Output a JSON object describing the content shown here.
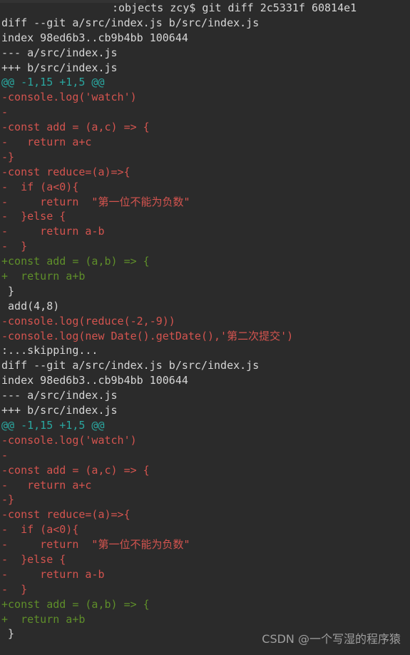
{
  "terminal": {
    "background_color": "#2b2b2b",
    "colors": {
      "default": "#d6d6d6",
      "hunk_header": "#2aa7a0",
      "deleted": "#d4544f",
      "added": "#5f8f2a",
      "watermark": "#a8a8a8"
    },
    "prompt": {
      "host_path": ":objects",
      "user": "zcy",
      "symbol": "$",
      "command": "git diff 2c5331f 60814e1",
      "full_line": ":objects zcy$ git diff 2c5331f 60814e1"
    },
    "lines": [
      {
        "text": ":objects zcy$ git diff 2c5331f 60814e1",
        "role": "prompt"
      },
      {
        "text": "diff --git a/src/index.js b/src/index.js",
        "role": "meta"
      },
      {
        "text": "index 98ed6b3..cb9b4bb 100644",
        "role": "meta"
      },
      {
        "text": "--- a/src/index.js",
        "role": "meta"
      },
      {
        "text": "+++ b/src/index.js",
        "role": "meta"
      },
      {
        "text": "@@ -1,15 +1,5 @@",
        "role": "hunk"
      },
      {
        "text": "-console.log('watch')",
        "role": "del"
      },
      {
        "text": "-",
        "role": "del"
      },
      {
        "text": "-const add = (a,c) => {",
        "role": "del"
      },
      {
        "text": "-   return a+c",
        "role": "del"
      },
      {
        "text": "-}",
        "role": "del"
      },
      {
        "text": "-const reduce=(a)=>{",
        "role": "del"
      },
      {
        "text": "-  if (a<0){",
        "role": "del"
      },
      {
        "text": "-     return  \"第一位不能为负数\"",
        "role": "del"
      },
      {
        "text": "-  }else {",
        "role": "del"
      },
      {
        "text": "-     return a-b",
        "role": "del"
      },
      {
        "text": "-  }",
        "role": "del"
      },
      {
        "text": "+const add = (a,b) => {",
        "role": "add"
      },
      {
        "text": "+  return a+b",
        "role": "add"
      },
      {
        "text": " }",
        "role": "default"
      },
      {
        "text": " add(4,8)",
        "role": "default"
      },
      {
        "text": "-console.log(reduce(-2,-9))",
        "role": "del"
      },
      {
        "text": "-console.log(new Date().getDate(),'第二次提交')",
        "role": "del"
      },
      {
        "text": ":...skipping...",
        "role": "pager"
      },
      {
        "text": "diff --git a/src/index.js b/src/index.js",
        "role": "meta"
      },
      {
        "text": "index 98ed6b3..cb9b4bb 100644",
        "role": "meta"
      },
      {
        "text": "--- a/src/index.js",
        "role": "meta"
      },
      {
        "text": "+++ b/src/index.js",
        "role": "meta"
      },
      {
        "text": "@@ -1,15 +1,5 @@",
        "role": "hunk"
      },
      {
        "text": "-console.log('watch')",
        "role": "del"
      },
      {
        "text": "-",
        "role": "del"
      },
      {
        "text": "-const add = (a,c) => {",
        "role": "del"
      },
      {
        "text": "-   return a+c",
        "role": "del"
      },
      {
        "text": "-}",
        "role": "del"
      },
      {
        "text": "-const reduce=(a)=>{",
        "role": "del"
      },
      {
        "text": "-  if (a<0){",
        "role": "del"
      },
      {
        "text": "-     return  \"第一位不能为负数\"",
        "role": "del"
      },
      {
        "text": "-  }else {",
        "role": "del"
      },
      {
        "text": "-     return a-b",
        "role": "del"
      },
      {
        "text": "-  }",
        "role": "del"
      },
      {
        "text": "+const add = (a,b) => {",
        "role": "add"
      },
      {
        "text": "+  return a+b",
        "role": "add"
      },
      {
        "text": " }",
        "role": "default"
      }
    ]
  },
  "watermark": {
    "text": "CSDN @一个写湿的程序猿"
  }
}
